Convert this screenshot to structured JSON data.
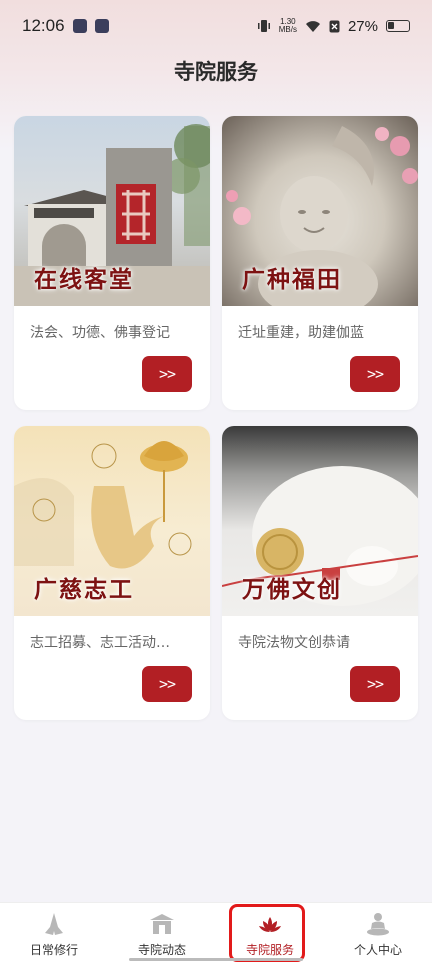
{
  "status_bar": {
    "time": "12:06",
    "net_speed_value": "1.30",
    "net_speed_unit": "MB/s",
    "battery": "27%"
  },
  "page_title": "寺院服务",
  "cards": [
    {
      "title": "在线客堂",
      "desc": "法会、功德、佛事登记",
      "button": ">>"
    },
    {
      "title": "广种福田",
      "desc": "迁址重建，助建伽蓝",
      "button": ">>"
    },
    {
      "title": "广慈志工",
      "desc": "志工招募、志工活动…",
      "button": ">>"
    },
    {
      "title": "万佛文创",
      "desc": "寺院法物文创恭请",
      "button": ">>"
    }
  ],
  "tabbar": {
    "tabs": [
      {
        "label": "日常修行",
        "icon": "praying-hands-icon"
      },
      {
        "label": "寺院动态",
        "icon": "temple-icon"
      },
      {
        "label": "寺院服务",
        "icon": "lotus-icon"
      },
      {
        "label": "个人中心",
        "icon": "meditation-icon"
      }
    ],
    "active_index": 2
  },
  "colors": {
    "accent": "#b21f24",
    "title_red": "#7d1212",
    "background": "#f4f3f8"
  }
}
